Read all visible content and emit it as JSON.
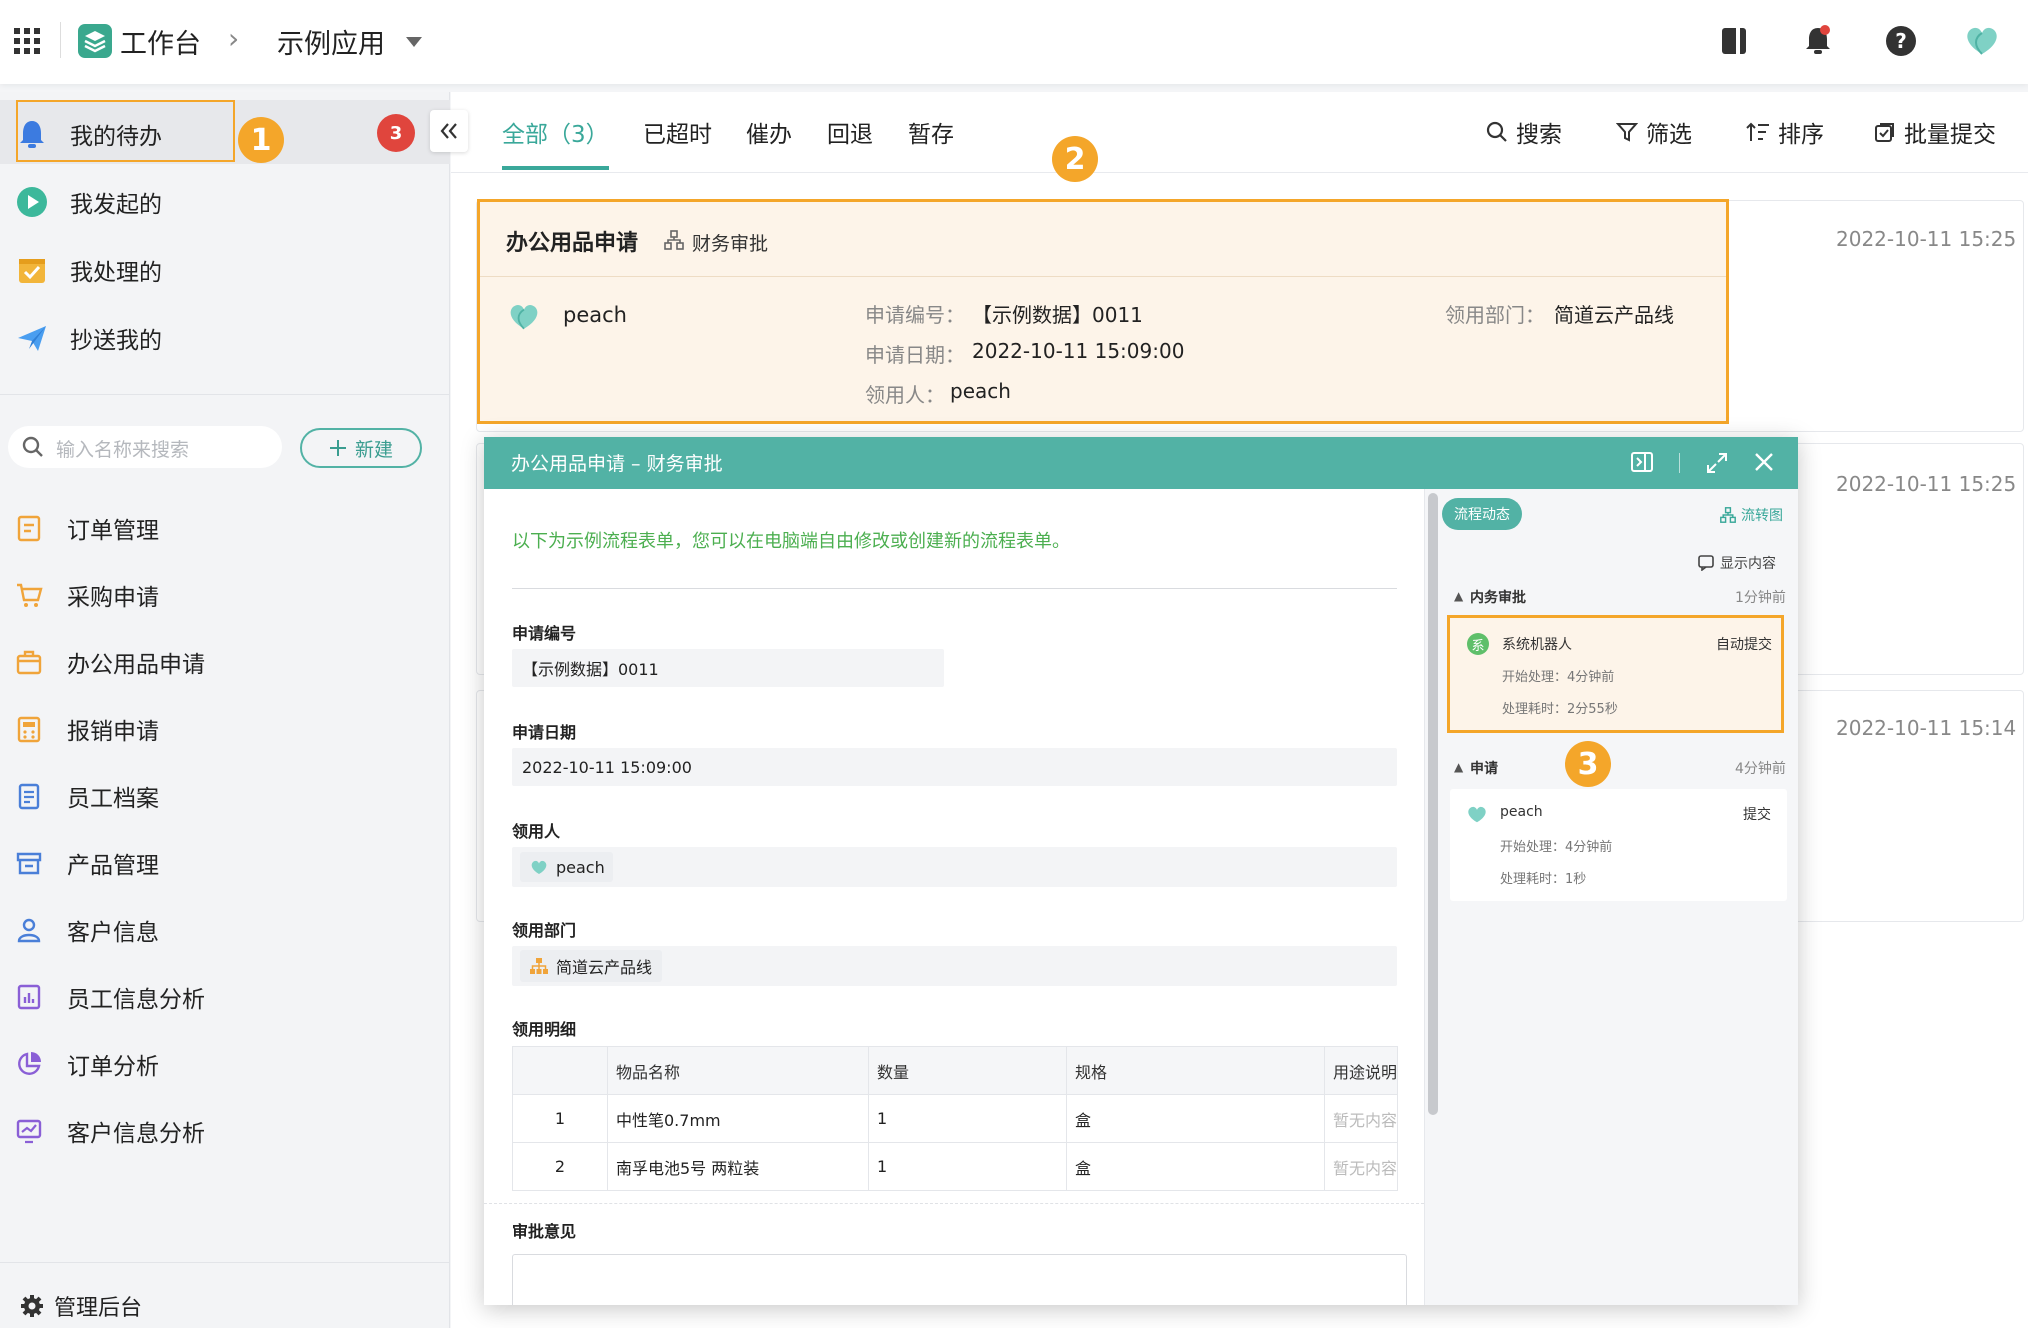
{
  "topbar": {
    "workbench": "工作台",
    "separator": "›",
    "app_name": "示例应用"
  },
  "sidebar": {
    "nav": [
      {
        "label": "我的待办",
        "badge": "3"
      },
      {
        "label": "我发起的"
      },
      {
        "label": "我处理的"
      },
      {
        "label": "抄送我的"
      }
    ],
    "search_placeholder": "输入名称来搜索",
    "new_button": "新建",
    "apps": [
      "订单管理",
      "采购申请",
      "办公用品申请",
      "报销申请",
      "员工档案",
      "产品管理",
      "客户信息",
      "员工信息分析",
      "订单分析",
      "客户信息分析"
    ],
    "admin": "管理后台"
  },
  "tabs": {
    "all": "全部（3）",
    "overdue": "已超时",
    "urge": "催办",
    "returned": "回退",
    "draft": "暂存"
  },
  "tools": {
    "search": "搜索",
    "filter": "筛选",
    "sort": "排序",
    "batch_submit": "批量提交"
  },
  "annotations": {
    "n1": "1",
    "n2": "2",
    "n3": "3"
  },
  "cards": [
    {
      "title": "办公用品申请",
      "node": "财务审批",
      "date": "2022-10-11 15:25",
      "user": "peach",
      "fields": {
        "apply_no_label": "申请编号：",
        "apply_no": "【示例数据】0011",
        "date_label": "申请日期：",
        "date": "2022-10-11 15:09:00",
        "receiver_label": "领用人：",
        "receiver": "peach",
        "dept_label": "领用部门：",
        "dept": "简道云产品线"
      }
    },
    {
      "date": "2022-10-11 15:25"
    },
    {
      "date": "2022-10-11 15:14"
    }
  ],
  "dialog": {
    "title": "办公用品申请 – 财务审批",
    "notice": "以下为示例流程表单，您可以在电脑端自由修改或创建新的流程表单。",
    "apply_no_label": "申请编号",
    "apply_no": "【示例数据】0011",
    "date_label": "申请日期",
    "date": "2022-10-11 15:09:00",
    "receiver_label": "领用人",
    "receiver": "peach",
    "dept_label": "领用部门",
    "dept": "简道云产品线",
    "detail_label": "领用明细",
    "table": {
      "headers": [
        "",
        "物品名称",
        "数量",
        "规格",
        "用途说明"
      ],
      "rows": [
        [
          "1",
          "中性笔0.7mm",
          "1",
          "盒",
          "暂无内容"
        ],
        [
          "2",
          "南孚电池5号 两粒装",
          "1",
          "盒",
          "暂无内容"
        ]
      ]
    },
    "opinion_label": "审批意见"
  },
  "flow": {
    "tag": "流程动态",
    "chart_link": "流转图",
    "show_content": "显示内容",
    "groups": [
      {
        "name": "内务审批",
        "time": "1分钟前",
        "user": "系统机器人",
        "avatar_char": "系",
        "action": "自动提交",
        "start": "开始处理：4分钟前",
        "cost": "处理耗时：2分55秒"
      },
      {
        "name": "申请",
        "time": "4分钟前",
        "user": "peach",
        "action": "提交",
        "start": "开始处理：4分钟前",
        "cost": "处理耗时：1秒"
      }
    ]
  },
  "colors": {
    "accent": "#44a99b",
    "header_teal": "#52b2a5",
    "highlight": "#f4a62a",
    "badge_red": "#e0453d"
  }
}
